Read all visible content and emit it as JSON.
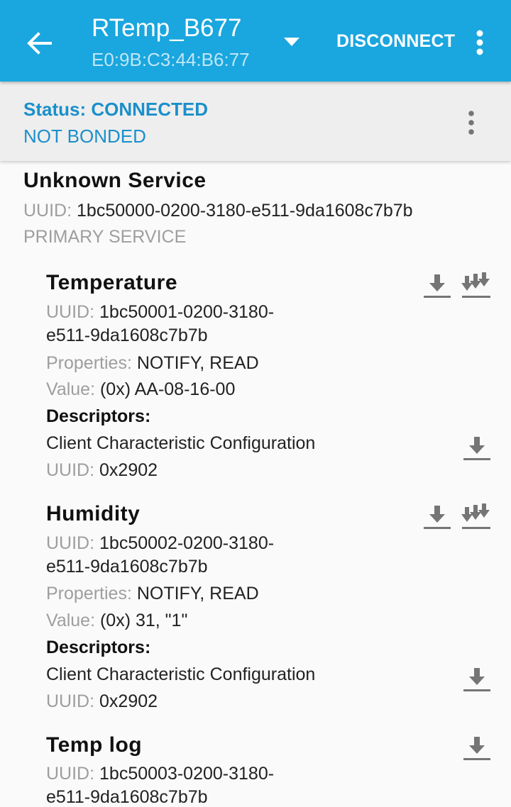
{
  "appbar": {
    "title": "RTemp_B677",
    "subtitle": "E0:9B:C3:44:B6:77",
    "disconnect_label": "DISCONNECT",
    "color": "#1aa6de"
  },
  "status": {
    "status_text": "Status: CONNECTED",
    "bond_text": "NOT BONDED",
    "accent": "#1b8fcb"
  },
  "service": {
    "name": "Unknown Service",
    "uuid_label": "UUID:",
    "uuid": "1bc50000-0200-3180-e511-9da1608c7b7b",
    "type": "PRIMARY SERVICE"
  },
  "characteristics": [
    {
      "name": "Temperature",
      "uuid_label": "UUID:",
      "uuid_line1": "1bc50001-0200-3180-",
      "uuid_line2": "e511-9da1608c7b7b",
      "properties_label": "Properties:",
      "properties": "NOTIFY, READ",
      "value_label": "Value:",
      "value": "(0x) AA-08-16-00",
      "descriptors_label": "Descriptors:",
      "descriptor_name": "Client Characteristic Configuration",
      "descriptor_uuid_label": "UUID:",
      "descriptor_uuid": "0x2902",
      "icons": [
        "read-icon",
        "notify-icon"
      ]
    },
    {
      "name": "Humidity",
      "uuid_label": "UUID:",
      "uuid_line1": "1bc50002-0200-3180-",
      "uuid_line2": "e511-9da1608c7b7b",
      "properties_label": "Properties:",
      "properties": "NOTIFY, READ",
      "value_label": "Value:",
      "value": "(0x) 31, \"1\"",
      "descriptors_label": "Descriptors:",
      "descriptor_name": "Client Characteristic Configuration",
      "descriptor_uuid_label": "UUID:",
      "descriptor_uuid": "0x2902",
      "icons": [
        "read-icon",
        "notify-icon"
      ]
    },
    {
      "name": "Temp log",
      "uuid_label": "UUID:",
      "uuid_line1": "1bc50003-0200-3180-",
      "uuid_line2": "e511-9da1608c7b7b",
      "icons": [
        "read-icon"
      ]
    }
  ]
}
